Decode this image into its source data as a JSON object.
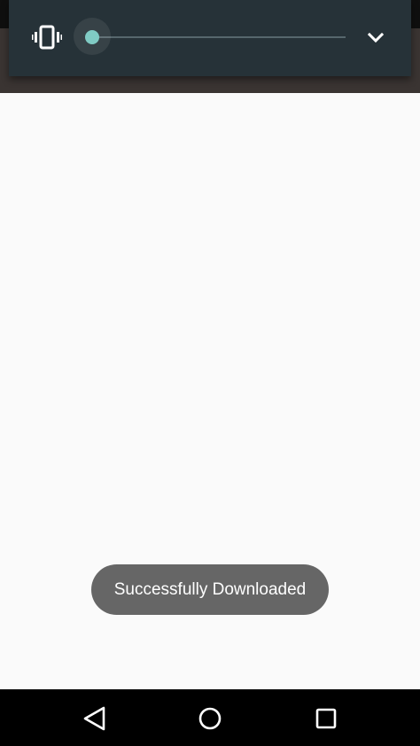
{
  "status_bar": {},
  "volume_panel": {
    "mode_icon": "vibrate-icon",
    "volume_level": 0.0,
    "expand_icon": "chevron-down-icon",
    "accent_color": "#80cbc4",
    "background_color": "#263238"
  },
  "toast": {
    "message": "Successfully Downloaded"
  },
  "nav_bar": {
    "back_icon": "back-triangle-icon",
    "home_icon": "home-circle-icon",
    "recents_icon": "recents-square-icon"
  }
}
